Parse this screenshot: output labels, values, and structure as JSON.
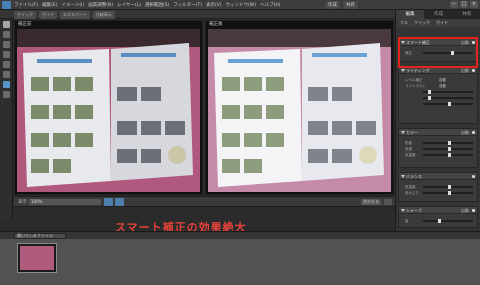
{
  "menubar": {
    "items": [
      "ファイル(F)",
      "編集(E)",
      "イメージ(I)",
      "画質調整(N)",
      "レイヤー(L)",
      "選択範囲(S)",
      "フィルター(T)",
      "表示(V)",
      "ウィンドウ(W)",
      "ヘルプ(H)"
    ],
    "right_buttons": [
      "作成",
      "共有",
      "作成",
      "共有"
    ],
    "window_controls": [
      "−",
      "□",
      "×"
    ]
  },
  "options_bar": {
    "buttons": [
      "クイック",
      "ガイド",
      "エキスパート",
      "比較表示"
    ]
  },
  "panes": {
    "before_label": "補正前",
    "after_label": "補正後"
  },
  "statusbar": {
    "zoom_label": "表示",
    "zoom_value": "100%",
    "fit_label": "合わせる"
  },
  "bin": {
    "select_label": "開いているファイル"
  },
  "caption": "スマート補正の効果絶大",
  "right_panel": {
    "tabs": [
      "編集",
      "作成",
      "共有"
    ],
    "active_tab_index": 0,
    "subtabs": [
      "フル",
      "クイック",
      "ガイド"
    ],
    "sections": [
      {
        "title": "スマート補正",
        "auto": "自動",
        "rows": [
          {
            "label": "補正",
            "type": "slider"
          }
        ]
      },
      {
        "title": "ライティング",
        "auto": "自動",
        "rows": [
          {
            "label": "レベル補正",
            "value": "自動"
          },
          {
            "label": "コントラスト",
            "value": "自動"
          },
          {
            "label": "",
            "type": "slider"
          },
          {
            "label": "",
            "type": "slider"
          },
          {
            "label": "",
            "type": "slider"
          }
        ]
      },
      {
        "title": "カラー",
        "auto": "自動",
        "rows": [
          {
            "label": "彩度",
            "type": "slider"
          },
          {
            "label": "色相",
            "type": "slider"
          },
          {
            "label": "色温度",
            "type": "slider"
          }
        ]
      },
      {
        "title": "バランス",
        "auto": "",
        "rows": [
          {
            "label": "色温度",
            "type": "slider"
          },
          {
            "label": "色かぶり",
            "type": "slider"
          }
        ]
      },
      {
        "title": "シャープ",
        "auto": "自動",
        "rows": [
          {
            "label": "量",
            "type": "slider"
          }
        ]
      }
    ]
  },
  "colors": {
    "highlight": "#e5231d",
    "caption": "#e8433a",
    "before_bg": "#b0587e",
    "after_bg": "#c48aa8"
  }
}
